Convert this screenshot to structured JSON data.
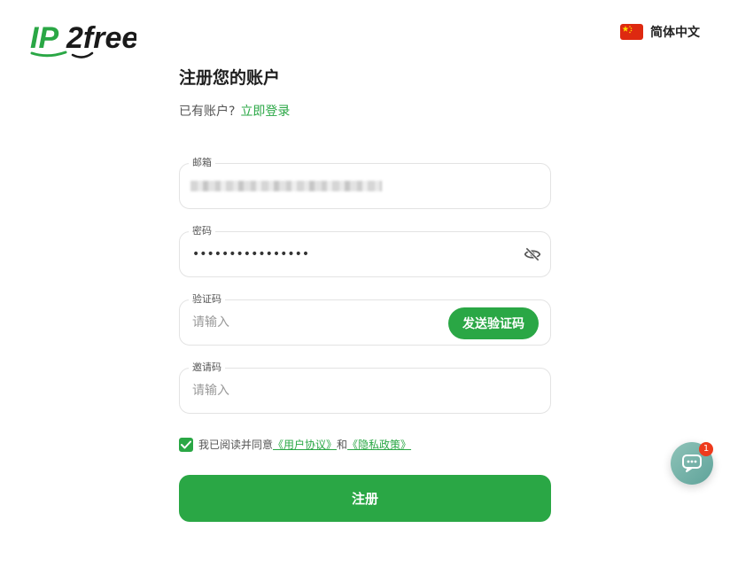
{
  "header": {
    "logo_text": "IP2free",
    "language": {
      "label": "简体中文",
      "flag_icon": "china-flag-icon"
    }
  },
  "form": {
    "title": "注册您的账户",
    "login_prompt": "已有账户?",
    "login_link": "立即登录",
    "email": {
      "label": "邮箱",
      "value_obscured": true
    },
    "password": {
      "label": "密码",
      "value": "••••••••••••••••",
      "toggle_icon": "eye-off-icon"
    },
    "verification_code": {
      "label": "验证码",
      "placeholder": "请输入",
      "send_button": "发送验证码"
    },
    "invite_code": {
      "label": "邀请码",
      "placeholder": "请输入"
    },
    "agreement": {
      "checked": true,
      "prefix": "我已阅读并同意",
      "user_agreement": "《用户协议》",
      "conjunction": "和",
      "privacy_policy": "《隐私政策》"
    },
    "submit_label": "注册"
  },
  "chat_widget": {
    "icon": "chat-icon",
    "badge_count": "1"
  },
  "colors": {
    "accent": "#2aa745",
    "flag_red": "#de2910",
    "badge_red": "#ee3a1c",
    "chat_bg": "#6fb0a6"
  }
}
